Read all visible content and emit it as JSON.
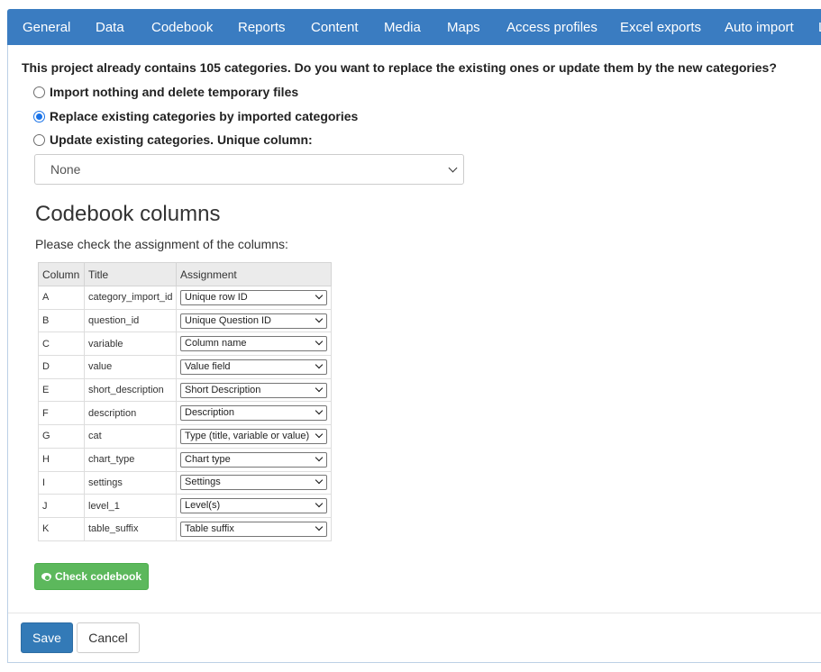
{
  "nav": {
    "tabs": [
      "General",
      "Data",
      "Codebook",
      "Reports",
      "Content",
      "Media",
      "Maps",
      "Access profiles",
      "Excel exports",
      "Auto import",
      "L"
    ]
  },
  "import": {
    "question": "This project already contains 105 categories. Do you want to replace the existing ones or update them by the new categories?",
    "options": [
      {
        "label": "Import nothing and delete temporary files",
        "checked": false
      },
      {
        "label": "Replace existing categories by imported categories",
        "checked": true
      },
      {
        "label": "Update existing categories. Unique column:",
        "checked": false
      }
    ],
    "unique_column_value": "None"
  },
  "codebook": {
    "heading": "Codebook columns",
    "instructions": "Please check the assignment of the columns:",
    "headers": {
      "column": "Column",
      "title": "Title",
      "assignment": "Assignment"
    },
    "rows": [
      {
        "column": "A",
        "title": "category_import_id",
        "assignment": "Unique row ID"
      },
      {
        "column": "B",
        "title": "question_id",
        "assignment": "Unique Question ID"
      },
      {
        "column": "C",
        "title": "variable",
        "assignment": "Column name"
      },
      {
        "column": "D",
        "title": "value",
        "assignment": "Value field"
      },
      {
        "column": "E",
        "title": "short_description",
        "assignment": "Short Description"
      },
      {
        "column": "F",
        "title": "description",
        "assignment": "Description"
      },
      {
        "column": "G",
        "title": "cat",
        "assignment": "Type (title, variable or value)"
      },
      {
        "column": "H",
        "title": "chart_type",
        "assignment": "Chart type"
      },
      {
        "column": "I",
        "title": "settings",
        "assignment": "Settings"
      },
      {
        "column": "J",
        "title": "level_1",
        "assignment": "Level(s)"
      },
      {
        "column": "K",
        "title": "table_suffix",
        "assignment": "Table suffix"
      }
    ],
    "check_button": "Check codebook"
  },
  "footer": {
    "save": "Save",
    "cancel": "Cancel"
  },
  "colors": {
    "nav": "#3a7cc1",
    "success": "#5cb85c",
    "primary": "#337ab7"
  },
  "icons": {
    "check_button": "eye-icon"
  }
}
